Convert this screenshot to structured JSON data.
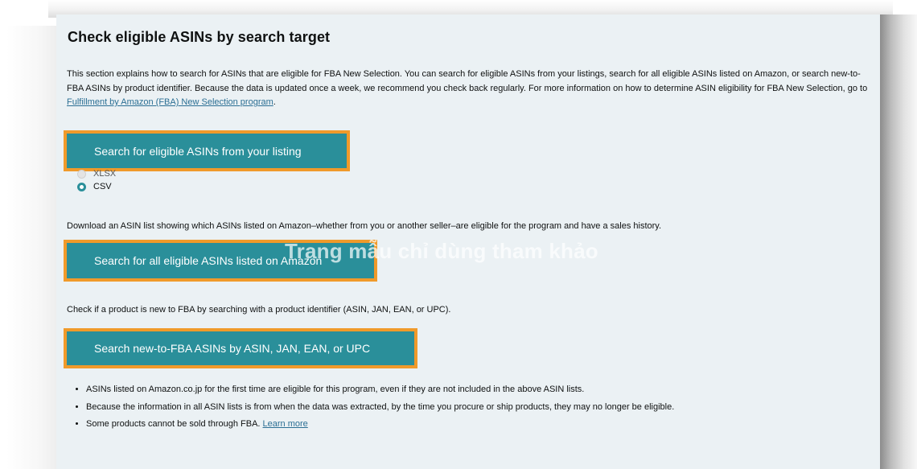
{
  "section": {
    "title": "Check eligible ASINs by search target",
    "intro_text": "This section explains how to search for ASINs that are eligible for FBA New Selection. You can search for eligible ASINs from your listings, search for all eligible ASINs listed on Amazon, or search new-to-FBA ASINs by product identifier. Because the data is updated once a week, we recommend you check back regularly. For more information on how to determine ASIN eligibility for FBA New Selection, go to ",
    "intro_link": "Fulfillment by Amazon (FBA) New Selection program",
    "intro_end": "."
  },
  "listing_search": {
    "button_label": "Search for eligible ASINs from your listing",
    "format_options": [
      {
        "label": "XLSX",
        "selected": false
      },
      {
        "label": "CSV",
        "selected": true
      }
    ]
  },
  "all_search": {
    "description": "Download an ASIN list showing which ASINs listed on Amazon–whether from you or another seller–are eligible for the program and have a sales history.",
    "button_label": "Search for all eligible ASINs listed on Amazon"
  },
  "new_search": {
    "description": "Check if a product is new to FBA by searching with a product identifier (ASIN, JAN, EAN, or UPC).",
    "button_label": "Search new-to-FBA ASINs by ASIN, JAN, EAN, or UPC"
  },
  "notes": {
    "item1": "ASINs listed on Amazon.co.jp for the first time are eligible for this program, even if they are not included in the above ASIN lists.",
    "item2": "Because the information in all ASIN lists is from when the data was extracted, by the time you procure or ship products, they may no longer be eligible.",
    "item3_text": "Some products cannot be sold through FBA. ",
    "item3_link": "Learn more"
  },
  "watermark": "Trang mẫu chỉ dùng tham khảo",
  "colors": {
    "button_bg": "#2a8f9a",
    "button_border": "#f09a2a",
    "panel_bg": "#ebf1f4",
    "link": "#2b6f94"
  }
}
